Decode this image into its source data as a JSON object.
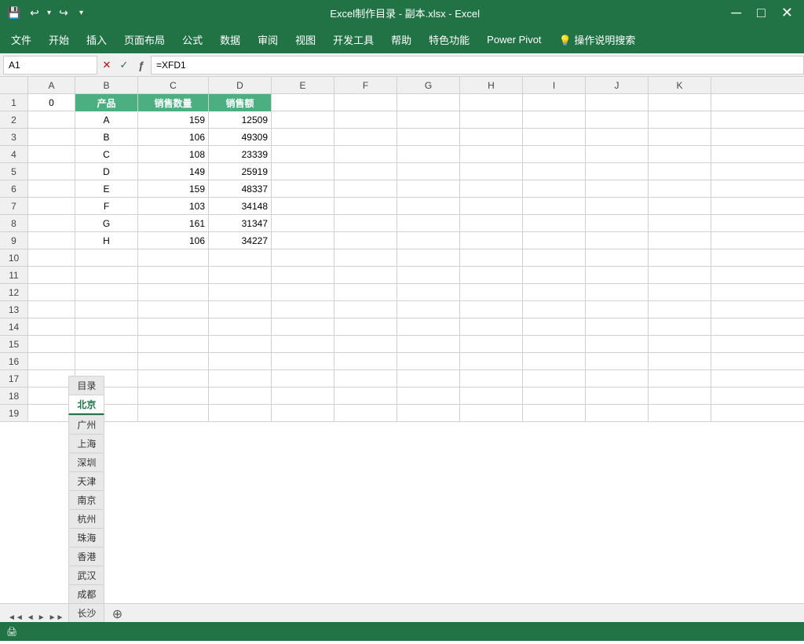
{
  "titleBar": {
    "title": "Excel制作目录 - 副本.xlsx  -  Excel",
    "saveIcon": "💾",
    "undoIcon": "↩",
    "redoIcon": "↪"
  },
  "menuBar": {
    "items": [
      "文件",
      "开始",
      "插入",
      "页面布局",
      "公式",
      "数据",
      "审阅",
      "视图",
      "开发工具",
      "帮助",
      "特色功能",
      "Power Pivot",
      "💡 操作说明搜索"
    ]
  },
  "formulaBar": {
    "nameBox": "A1",
    "formula": "=XFD1"
  },
  "columns": {
    "headers": [
      "",
      "A",
      "B",
      "C",
      "D",
      "E",
      "F",
      "G",
      "H",
      "I",
      "J",
      "K"
    ]
  },
  "rows": [
    {
      "num": 1,
      "a": "0",
      "b": "产品",
      "c": "销售数量",
      "d": "销售额",
      "e": "",
      "f": "",
      "g": "",
      "h": "",
      "i": "",
      "j": "",
      "k": "",
      "isHeader": true
    },
    {
      "num": 2,
      "a": "",
      "b": "A",
      "c": "159",
      "d": "12509",
      "e": "",
      "f": "",
      "g": "",
      "h": "",
      "i": "",
      "j": "",
      "k": "",
      "isHeader": false
    },
    {
      "num": 3,
      "a": "",
      "b": "B",
      "c": "106",
      "d": "49309",
      "e": "",
      "f": "",
      "g": "",
      "h": "",
      "i": "",
      "j": "",
      "k": "",
      "isHeader": false
    },
    {
      "num": 4,
      "a": "",
      "b": "C",
      "c": "108",
      "d": "23339",
      "e": "",
      "f": "",
      "g": "",
      "h": "",
      "i": "",
      "j": "",
      "k": "",
      "isHeader": false
    },
    {
      "num": 5,
      "a": "",
      "b": "D",
      "c": "149",
      "d": "25919",
      "e": "",
      "f": "",
      "g": "",
      "h": "",
      "i": "",
      "j": "",
      "k": "",
      "isHeader": false
    },
    {
      "num": 6,
      "a": "",
      "b": "E",
      "c": "159",
      "d": "48337",
      "e": "",
      "f": "",
      "g": "",
      "h": "",
      "i": "",
      "j": "",
      "k": "",
      "isHeader": false
    },
    {
      "num": 7,
      "a": "",
      "b": "F",
      "c": "103",
      "d": "34148",
      "e": "",
      "f": "",
      "g": "",
      "h": "",
      "i": "",
      "j": "",
      "k": "",
      "isHeader": false
    },
    {
      "num": 8,
      "a": "",
      "b": "G",
      "c": "161",
      "d": "31347",
      "e": "",
      "f": "",
      "g": "",
      "h": "",
      "i": "",
      "j": "",
      "k": "",
      "isHeader": false
    },
    {
      "num": 9,
      "a": "",
      "b": "H",
      "c": "106",
      "d": "34227",
      "e": "",
      "f": "",
      "g": "",
      "h": "",
      "i": "",
      "j": "",
      "k": "",
      "isHeader": false
    },
    {
      "num": 10,
      "a": "",
      "b": "",
      "c": "",
      "d": "",
      "e": "",
      "f": "",
      "g": "",
      "h": "",
      "i": "",
      "j": "",
      "k": "",
      "isHeader": false
    },
    {
      "num": 11,
      "a": "",
      "b": "",
      "c": "",
      "d": "",
      "e": "",
      "f": "",
      "g": "",
      "h": "",
      "i": "",
      "j": "",
      "k": "",
      "isHeader": false
    },
    {
      "num": 12,
      "a": "",
      "b": "",
      "c": "",
      "d": "",
      "e": "",
      "f": "",
      "g": "",
      "h": "",
      "i": "",
      "j": "",
      "k": "",
      "isHeader": false
    },
    {
      "num": 13,
      "a": "",
      "b": "",
      "c": "",
      "d": "",
      "e": "",
      "f": "",
      "g": "",
      "h": "",
      "i": "",
      "j": "",
      "k": "",
      "isHeader": false
    },
    {
      "num": 14,
      "a": "",
      "b": "",
      "c": "",
      "d": "",
      "e": "",
      "f": "",
      "g": "",
      "h": "",
      "i": "",
      "j": "",
      "k": "",
      "isHeader": false
    },
    {
      "num": 15,
      "a": "",
      "b": "",
      "c": "",
      "d": "",
      "e": "",
      "f": "",
      "g": "",
      "h": "",
      "i": "",
      "j": "",
      "k": "",
      "isHeader": false
    },
    {
      "num": 16,
      "a": "",
      "b": "",
      "c": "",
      "d": "",
      "e": "",
      "f": "",
      "g": "",
      "h": "",
      "i": "",
      "j": "",
      "k": "",
      "isHeader": false
    },
    {
      "num": 17,
      "a": "",
      "b": "",
      "c": "",
      "d": "",
      "e": "",
      "f": "",
      "g": "",
      "h": "",
      "i": "",
      "j": "",
      "k": "",
      "isHeader": false
    },
    {
      "num": 18,
      "a": "",
      "b": "",
      "c": "",
      "d": "",
      "e": "",
      "f": "",
      "g": "",
      "h": "",
      "i": "",
      "j": "",
      "k": "",
      "isHeader": false
    },
    {
      "num": 19,
      "a": "",
      "b": "",
      "c": "",
      "d": "",
      "e": "",
      "f": "",
      "g": "",
      "h": "",
      "i": "",
      "j": "",
      "k": "",
      "isHeader": false
    }
  ],
  "sheetTabs": {
    "tabs": [
      "目录",
      "北京",
      "广州",
      "上海",
      "深圳",
      "天津",
      "南京",
      "杭州",
      "珠海",
      "香港",
      "武汉",
      "成都",
      "长沙"
    ],
    "activeTab": "北京"
  },
  "statusBar": {
    "text": "🖨"
  }
}
